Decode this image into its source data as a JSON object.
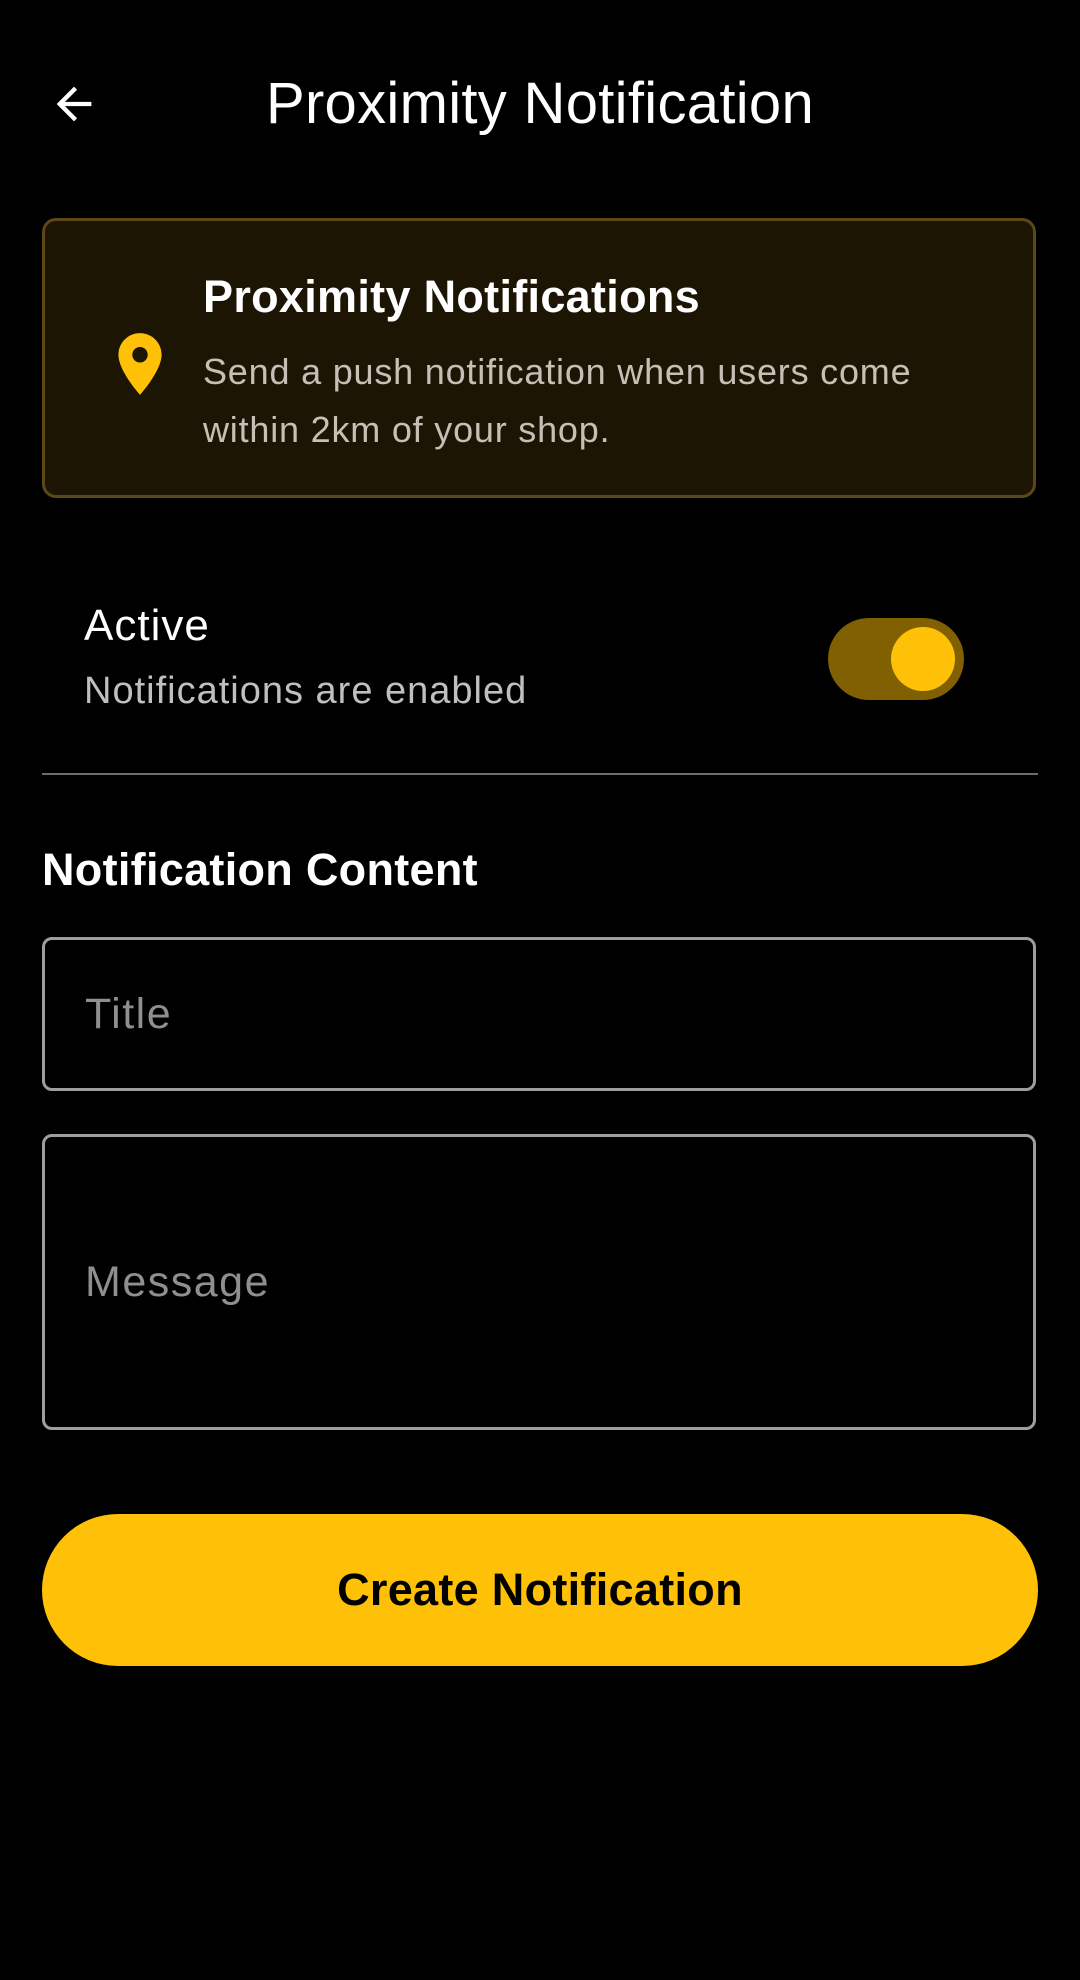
{
  "header": {
    "back_icon": "arrow-left-icon",
    "title": "Proximity Notification"
  },
  "info_card": {
    "icon": "location-pin-icon",
    "title": "Proximity Notifications",
    "description": "Send a push notification when users come within 2km of your shop."
  },
  "active_setting": {
    "label": "Active",
    "status_text": "Notifications are enabled",
    "enabled": true
  },
  "content_section": {
    "heading": "Notification Content",
    "title_field": {
      "placeholder": "Title",
      "value": ""
    },
    "message_field": {
      "placeholder": "Message",
      "value": ""
    }
  },
  "actions": {
    "create_label": "Create Notification"
  },
  "colors": {
    "background": "#000000",
    "accent": "#ffc107",
    "toggle_track": "#806000",
    "card_background": "#1d1504",
    "card_border": "#5c4814"
  }
}
